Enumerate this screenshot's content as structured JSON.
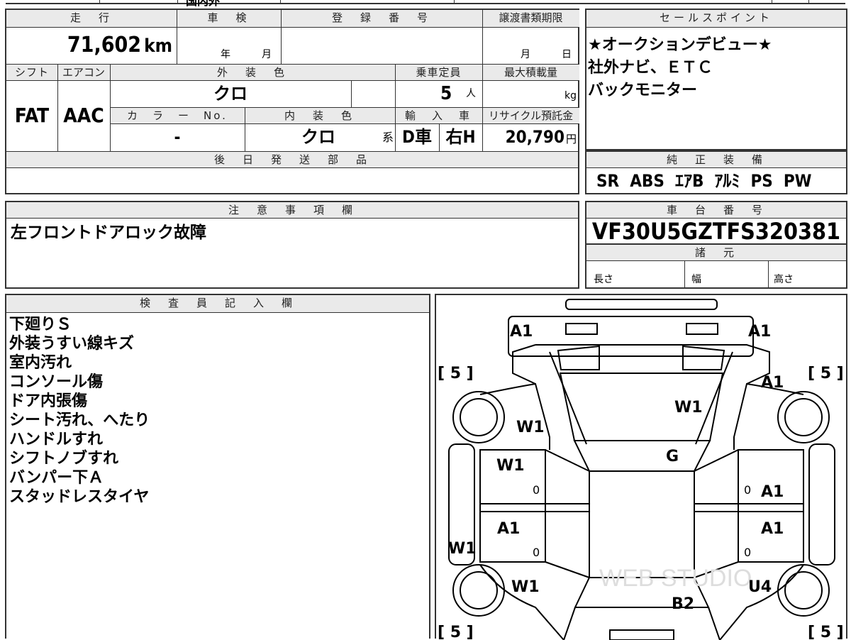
{
  "top_strip": {
    "partial_text": "国内外"
  },
  "vehicle_info": {
    "mileage": {
      "header": "走　行",
      "value": "71,602",
      "unit": "km"
    },
    "inspection": {
      "header": "車　検",
      "year_label": "年",
      "month_label": "月"
    },
    "registration": {
      "header": "登　録　番　号"
    },
    "transfer_deadline": {
      "header": "譲渡書類期限",
      "month_label": "月",
      "day_label": "日"
    },
    "shift": {
      "header": "シフト",
      "value": "FAT"
    },
    "aircon": {
      "header": "エアコン",
      "value": "AAC"
    },
    "exterior_color": {
      "header": "外　装　色",
      "value": "クロ"
    },
    "capacity": {
      "header": "乗車定員",
      "value": "5",
      "unit": "人"
    },
    "max_load": {
      "header": "最大積載量",
      "unit": "kg"
    },
    "color_no": {
      "header": "カ　ラ　ー　No.",
      "value": "-"
    },
    "interior_color": {
      "header": "内　装　色",
      "value": "クロ",
      "suffix": "系"
    },
    "import": {
      "header": "輸　入　車",
      "dealer": "D車",
      "steering": "右H"
    },
    "recycle": {
      "header": "リサイクル預託金",
      "value": "20,790",
      "unit": "円"
    },
    "later_parts": {
      "header": "後　日　発　送　部　品",
      "value": ""
    }
  },
  "sales_points": {
    "header": "セールスポイント",
    "lines": [
      "★オークションデビュー★",
      "社外ナビ、ＥＴＣ",
      "バックモニター"
    ]
  },
  "genuine_equipment": {
    "header": "純　正　装　備",
    "value": "SR  ABS  ｴｱB  ｱﾙﾐ  PS  PW"
  },
  "caution": {
    "header": "注　意　事　項　欄",
    "text": "左フロントドアロック故障"
  },
  "chassis": {
    "header": "車　台　番　号",
    "number": "VF30U5GZTFS320381"
  },
  "specs": {
    "header": "諸　元",
    "length": "長さ",
    "width": "幅",
    "height": "高さ"
  },
  "inspector": {
    "header": "検　査　員　記　入　欄",
    "lines": [
      "下廻りＳ",
      "外装うすい線キズ",
      "室内汚れ",
      "コンソール傷",
      "ドア内張傷",
      "シート汚れ、へたり",
      "ハンドルすれ",
      "シフトノブすれ",
      "バンパー下Ａ",
      "スタッドレスタイヤ"
    ]
  },
  "diagram": {
    "watermark": "WEB STUDIO",
    "marks": {
      "front_left": "A1",
      "front_right": "A1",
      "hood": "W1",
      "roof": "G",
      "front_fender_left": "W1",
      "front_door_left": "W1",
      "rear_door_left": "A1",
      "sill_left": "W1",
      "rear_fender_left": "W1",
      "front_fender_right": "A1",
      "front_door_right": "A1",
      "rear_door_right": "A1",
      "rear_fender_right": "U4",
      "trunk": "B2",
      "tire_fl": "[ 5 ]",
      "tire_fr": "[ 5 ]",
      "tire_rl": "[ 5 ]",
      "tire_rr": "[ 5 ]",
      "zero": "0"
    }
  }
}
